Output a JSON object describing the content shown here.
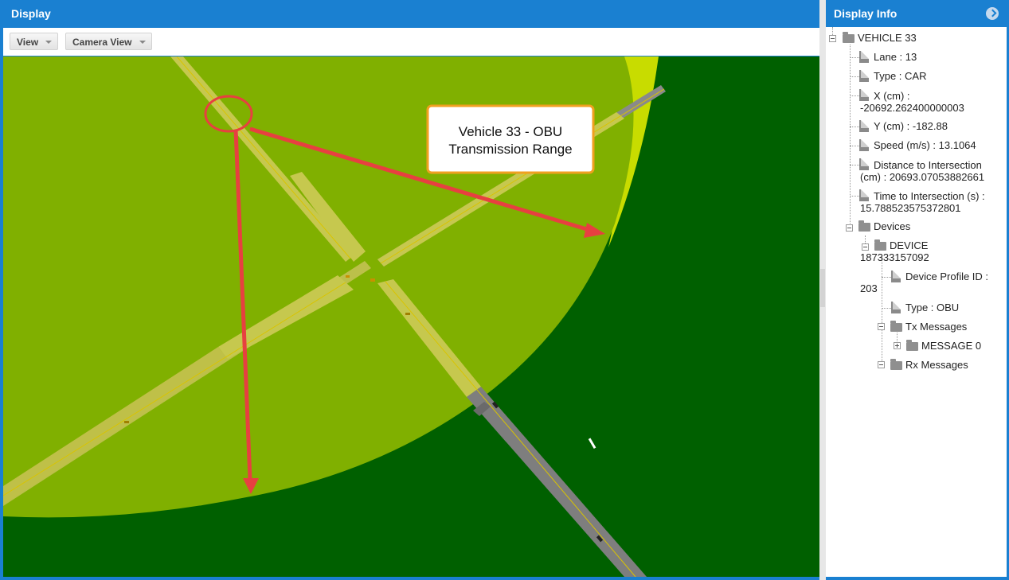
{
  "display": {
    "title": "Display",
    "toolbar": {
      "view_label": "View",
      "camera_view_label": "Camera View"
    },
    "annotation": {
      "line1": "Vehicle 33 - OBU",
      "line2": "Transmission Range"
    },
    "colors": {
      "range_fill": "#80b000",
      "background": "#006000",
      "road": "#7a7a7a",
      "annotation_red": "#e74040",
      "callout_border": "#f0a020"
    }
  },
  "info": {
    "title": "Display Info",
    "vehicle": "VEHICLE 33",
    "props": {
      "lane": "Lane : 13",
      "type": "Type : CAR",
      "x1": "X (cm) :",
      "x2": "-20692.262400000003",
      "y": "Y (cm) : -182.88",
      "speed": "Speed (m/s) : 13.1064",
      "dist1": "Distance to Intersection",
      "dist2": "(cm) : 20693.07053882661",
      "time1": "Time to Intersection (s) :",
      "time2": "15.788523575372801"
    },
    "devices": "Devices",
    "device1": "DEVICE",
    "device2": "187333157092",
    "profile1": "Device Profile ID :",
    "profile2": "203",
    "device_type": "Type : OBU",
    "tx": "Tx Messages",
    "message0": "MESSAGE 0",
    "rx": "Rx Messages"
  }
}
